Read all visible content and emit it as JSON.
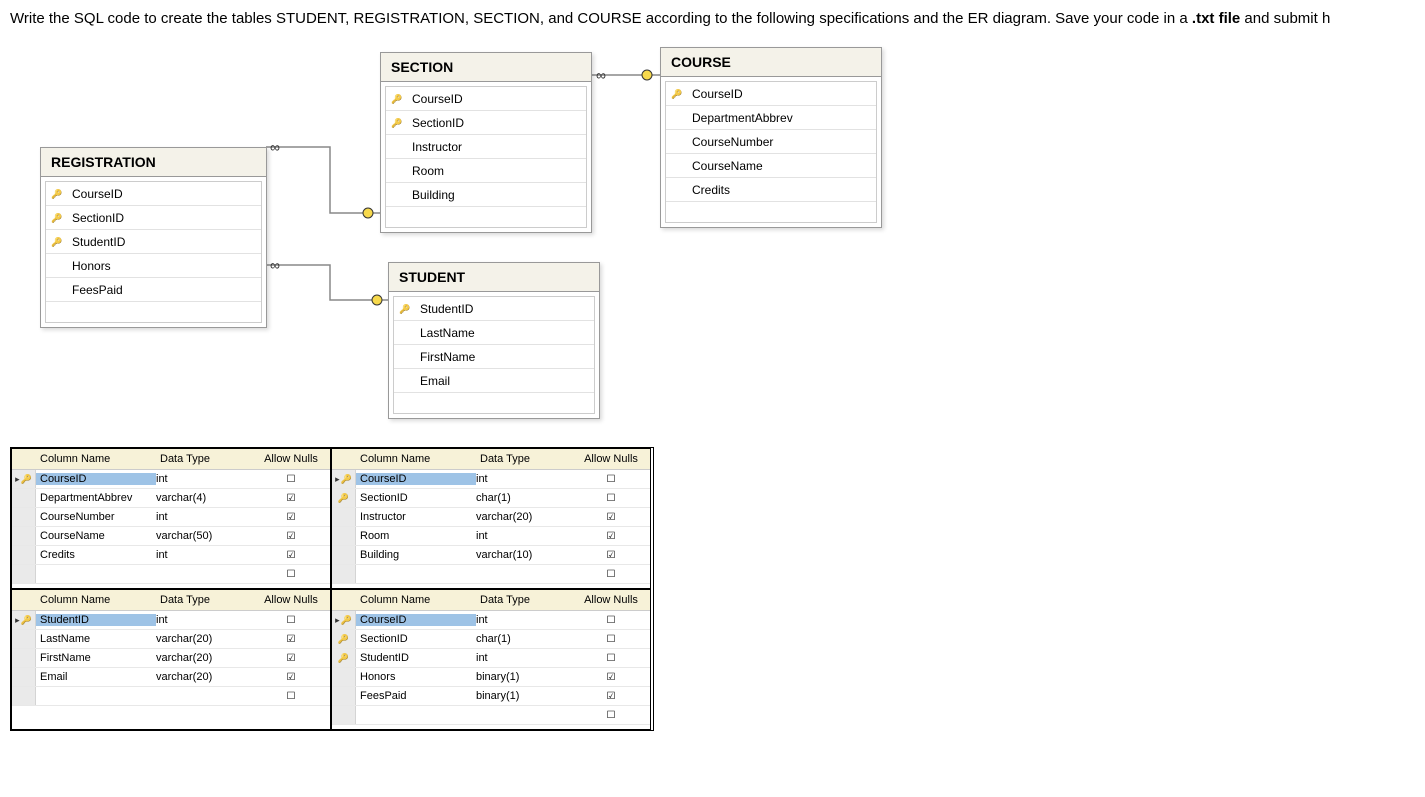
{
  "instruction_prefix": "Write the SQL code to create the tables STUDENT, REGISTRATION, SECTION, and COURSE according to the following specifications and the ER diagram. Save your code in a ",
  "instruction_bold": ".txt file",
  "instruction_suffix": " and submit h",
  "er": {
    "registration": {
      "title": "REGISTRATION",
      "cols": [
        {
          "name": "CourseID",
          "key": true
        },
        {
          "name": "SectionID",
          "key": true
        },
        {
          "name": "StudentID",
          "key": true
        },
        {
          "name": "Honors",
          "key": false
        },
        {
          "name": "FeesPaid",
          "key": false
        }
      ]
    },
    "section": {
      "title": "SECTION",
      "cols": [
        {
          "name": "CourseID",
          "key": true
        },
        {
          "name": "SectionID",
          "key": true
        },
        {
          "name": "Instructor",
          "key": false
        },
        {
          "name": "Room",
          "key": false
        },
        {
          "name": "Building",
          "key": false
        }
      ]
    },
    "course": {
      "title": "COURSE",
      "cols": [
        {
          "name": "CourseID",
          "key": true
        },
        {
          "name": "DepartmentAbbrev",
          "key": false
        },
        {
          "name": "CourseNumber",
          "key": false
        },
        {
          "name": "CourseName",
          "key": false
        },
        {
          "name": "Credits",
          "key": false
        }
      ]
    },
    "student": {
      "title": "STUDENT",
      "cols": [
        {
          "name": "StudentID",
          "key": true
        },
        {
          "name": "LastName",
          "key": false
        },
        {
          "name": "FirstName",
          "key": false
        },
        {
          "name": "Email",
          "key": false
        }
      ]
    }
  },
  "designer_headers": {
    "col": "Column Name",
    "type": "Data Type",
    "nulls": "Allow Nulls"
  },
  "designer": {
    "course": {
      "rows": [
        {
          "name": "CourseID",
          "type": "int",
          "nulls": false,
          "key": true,
          "selected": true,
          "arrow": true
        },
        {
          "name": "DepartmentAbbrev",
          "type": "varchar(4)",
          "nulls": true,
          "key": false
        },
        {
          "name": "CourseNumber",
          "type": "int",
          "nulls": true,
          "key": false
        },
        {
          "name": "CourseName",
          "type": "varchar(50)",
          "nulls": true,
          "key": false
        },
        {
          "name": "Credits",
          "type": "int",
          "nulls": true,
          "key": false
        },
        {
          "name": "",
          "type": "",
          "nulls": false,
          "empty": true
        }
      ]
    },
    "section": {
      "rows": [
        {
          "name": "CourseID",
          "type": "int",
          "nulls": false,
          "key": true,
          "selected": true,
          "arrow": true
        },
        {
          "name": "SectionID",
          "type": "char(1)",
          "nulls": false,
          "key": true
        },
        {
          "name": "Instructor",
          "type": "varchar(20)",
          "nulls": true,
          "key": false
        },
        {
          "name": "Room",
          "type": "int",
          "nulls": true,
          "key": false
        },
        {
          "name": "Building",
          "type": "varchar(10)",
          "nulls": true,
          "key": false
        },
        {
          "name": "",
          "type": "",
          "nulls": false,
          "empty": true
        }
      ]
    },
    "student": {
      "rows": [
        {
          "name": "StudentID",
          "type": "int",
          "nulls": false,
          "key": true,
          "selected": true,
          "arrow": true
        },
        {
          "name": "LastName",
          "type": "varchar(20)",
          "nulls": true,
          "key": false
        },
        {
          "name": "FirstName",
          "type": "varchar(20)",
          "nulls": true,
          "key": false
        },
        {
          "name": "Email",
          "type": "varchar(20)",
          "nulls": true,
          "key": false
        },
        {
          "name": "",
          "type": "",
          "nulls": false,
          "empty": true
        }
      ]
    },
    "registration": {
      "rows": [
        {
          "name": "CourseID",
          "type": "int",
          "nulls": false,
          "key": true,
          "selected": true,
          "arrow": true
        },
        {
          "name": "SectionID",
          "type": "char(1)",
          "nulls": false,
          "key": true
        },
        {
          "name": "StudentID",
          "type": "int",
          "nulls": false,
          "key": true
        },
        {
          "name": "Honors",
          "type": "binary(1)",
          "nulls": true,
          "key": false
        },
        {
          "name": "FeesPaid",
          "type": "binary(1)",
          "nulls": true,
          "key": false
        },
        {
          "name": "",
          "type": "",
          "nulls": false,
          "empty": true
        }
      ]
    }
  }
}
